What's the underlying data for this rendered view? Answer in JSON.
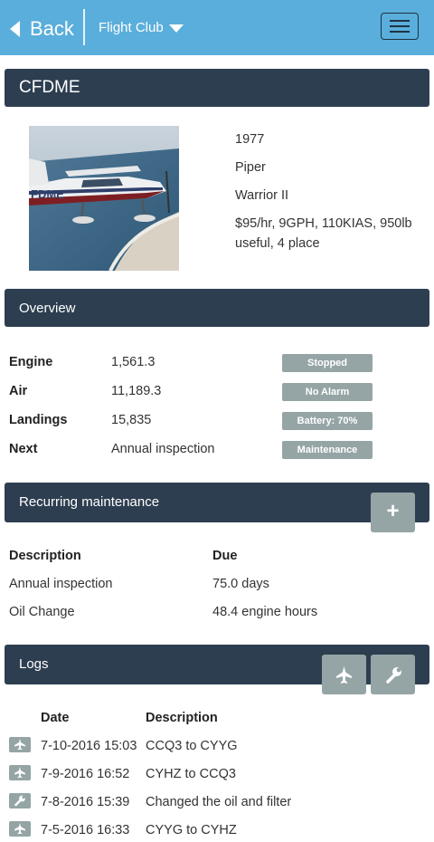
{
  "nav": {
    "back_label": "Back",
    "club_label": "Flight Club"
  },
  "aircraft": {
    "registration": "CFDME",
    "year": "1977",
    "make": "Piper",
    "model": "Warrior II",
    "specs_line1": "$95/hr, 9GPH, 110KIAS, 950lb",
    "specs_line2": "useful, 4 place",
    "photo_marking": "FDME"
  },
  "overview": {
    "title": "Overview",
    "rows": [
      {
        "label": "Engine",
        "value": "1,561.3",
        "badge": "Stopped"
      },
      {
        "label": "Air",
        "value": "11,189.3",
        "badge": "No Alarm"
      },
      {
        "label": "Landings",
        "value": "15,835",
        "badge": "Battery: 70%"
      },
      {
        "label": "Next",
        "value": "Annual inspection",
        "badge": "Maintenance"
      }
    ]
  },
  "maintenance": {
    "title": "Recurring maintenance",
    "add_glyph": "+",
    "col_description": "Description",
    "col_due": "Due",
    "items": [
      {
        "description": "Annual inspection",
        "due": "75.0 days"
      },
      {
        "description": "Oil Change",
        "due": "48.4 engine hours"
      }
    ]
  },
  "logs": {
    "title": "Logs",
    "col_date": "Date",
    "col_description": "Description",
    "entries": [
      {
        "icon": "airplane-icon",
        "date": "7-10-2016 15:03",
        "description": "CCQ3 to CYYG"
      },
      {
        "icon": "airplane-icon",
        "date": "7-9-2016 16:52",
        "description": "CYHZ to CCQ3"
      },
      {
        "icon": "wrench-icon",
        "date": "7-8-2016 15:39",
        "description": "Changed the oil and filter"
      },
      {
        "icon": "airplane-icon",
        "date": "7-5-2016 16:33",
        "description": "CYYG to CYHZ"
      }
    ]
  },
  "colors": {
    "topbar": "#5aaedb",
    "panel": "#2d3e50",
    "badge": "#95a5a6"
  }
}
